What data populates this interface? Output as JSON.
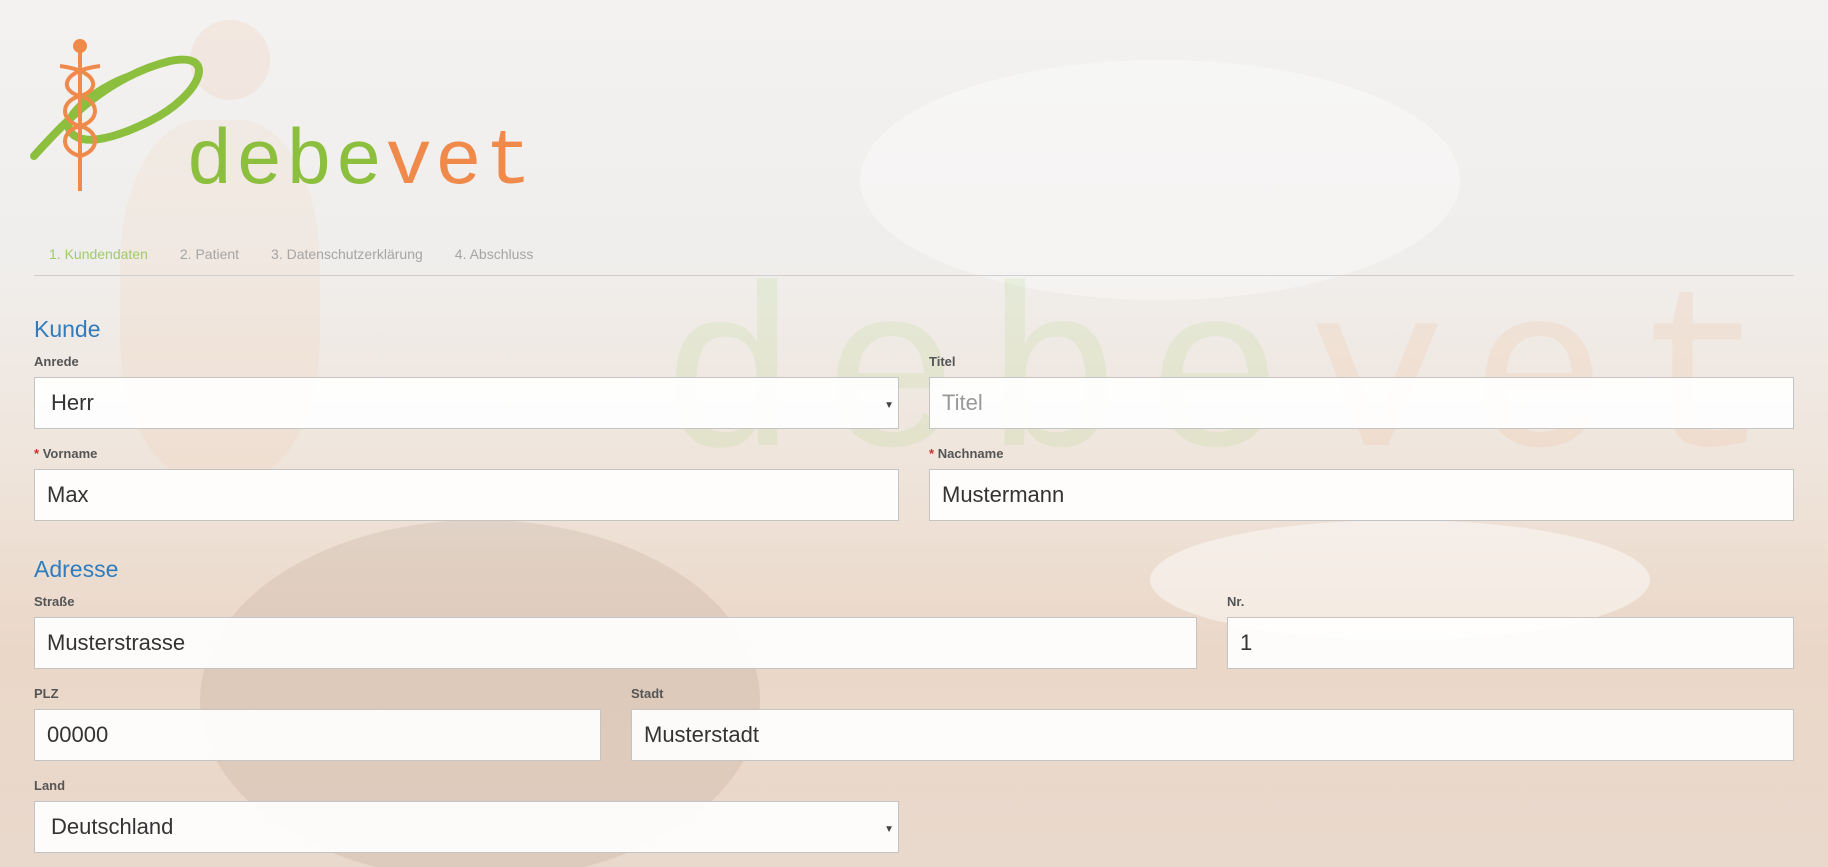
{
  "brand": {
    "name_part1": "debe",
    "name_part2": "vet"
  },
  "steps": [
    {
      "label": "1. Kundendaten"
    },
    {
      "label": "2. Patient"
    },
    {
      "label": "3. Datenschutzerklärung"
    },
    {
      "label": "4. Abschluss"
    }
  ],
  "kunde": {
    "title": "Kunde",
    "anrede": {
      "label": "Anrede",
      "value": "Herr"
    },
    "titel": {
      "label": "Titel",
      "placeholder": "Titel"
    },
    "vorname": {
      "required_mark": "*",
      "label": "Vorname",
      "value": "Max"
    },
    "nachname": {
      "required_mark": "*",
      "label": "Nachname",
      "value": "Mustermann"
    }
  },
  "adresse": {
    "title": "Adresse",
    "strasse": {
      "label": "Straße",
      "value": "Musterstrasse"
    },
    "nr": {
      "label": "Nr.",
      "value": "1"
    },
    "plz": {
      "label": "PLZ",
      "value": "00000"
    },
    "stadt": {
      "label": "Stadt",
      "value": "Musterstadt"
    },
    "land": {
      "label": "Land",
      "value": "Deutschland"
    }
  },
  "colors": {
    "accent_blue": "#2f7cbf",
    "brand_green": "#8dbf3f",
    "brand_orange": "#f08a4b",
    "step_active": "#9fcb68"
  },
  "icons": {
    "select_caret": "caret-down-icon"
  }
}
